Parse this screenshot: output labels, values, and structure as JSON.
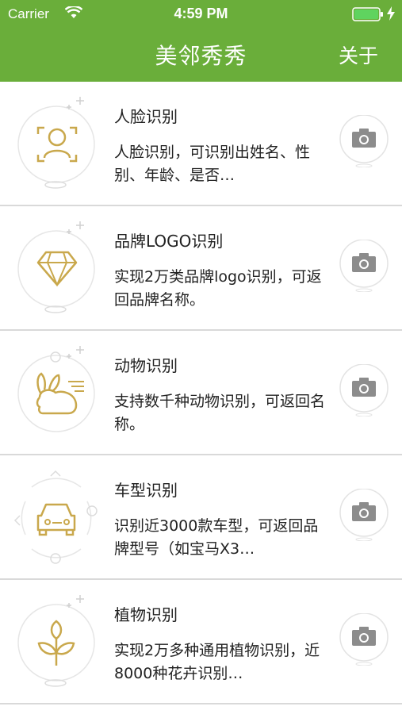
{
  "status_bar": {
    "carrier": "Carrier",
    "time": "4:59 PM"
  },
  "nav": {
    "title": "美邻秀秀",
    "about_label": "关于"
  },
  "colors": {
    "header_green": "#6aae3a",
    "icon_gold": "#c9a84c",
    "divider": "#d9d9d9"
  },
  "items": [
    {
      "title": "人脸识别",
      "description": "人脸识别，可识别出姓名、性别、年龄、是否…",
      "icon": "face-icon"
    },
    {
      "title": "品牌LOGO识别",
      "description": "实现2万类品牌logo识别，可返回品牌名称。",
      "icon": "diamond-icon"
    },
    {
      "title": "动物识别",
      "description": "支持数千种动物识别，可返回名称。",
      "icon": "rabbit-icon"
    },
    {
      "title": "车型识别",
      "description": "识别近3000款车型，可返回品牌型号（如宝马X3…",
      "icon": "car-icon"
    },
    {
      "title": "植物识别",
      "description": "实现2万多种通用植物识别，近8000种花卉识别…",
      "icon": "plant-icon"
    }
  ]
}
